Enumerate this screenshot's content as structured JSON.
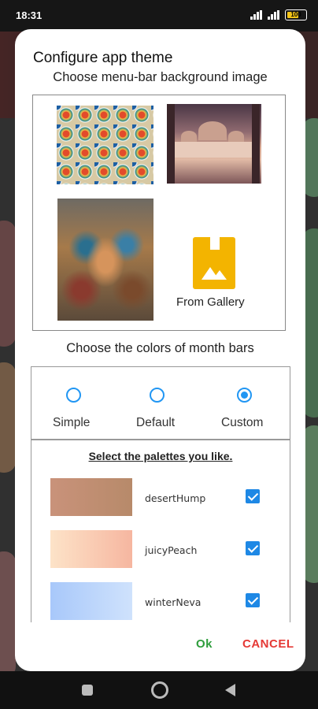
{
  "status": {
    "time": "18:31",
    "battery": "100"
  },
  "dialog": {
    "title": "Configure app theme",
    "menu_bar_label": "Choose menu-bar background image",
    "images": [
      {
        "name": "mosaic-tiles"
      },
      {
        "name": "mosque-sunset"
      },
      {
        "name": "butterfly-art"
      }
    ],
    "gallery_label": "From Gallery",
    "month_colors_label": "Choose the colors of month bars",
    "radios": [
      {
        "label": "Simple",
        "checked": false
      },
      {
        "label": "Default",
        "checked": false
      },
      {
        "label": "Custom",
        "checked": true
      }
    ],
    "palette_heading": "Select the palettes you like.",
    "palettes": [
      {
        "name": "desertHump",
        "checked": true,
        "colors": [
          "#c9927a",
          "#b78a6a"
        ]
      },
      {
        "name": "juicyPeach",
        "checked": true,
        "colors": [
          "#fde3c8",
          "#f6b6a0"
        ]
      },
      {
        "name": "winterNeva",
        "checked": true,
        "colors": [
          "#a8c8fa",
          "#cfe2fc"
        ]
      }
    ],
    "ok_label": "Ok",
    "cancel_label": "CANCEL"
  },
  "colors": {
    "accent": "#2196f3",
    "ok": "#2e9d3c",
    "cancel": "#e53935",
    "gallery": "#f3b400"
  }
}
